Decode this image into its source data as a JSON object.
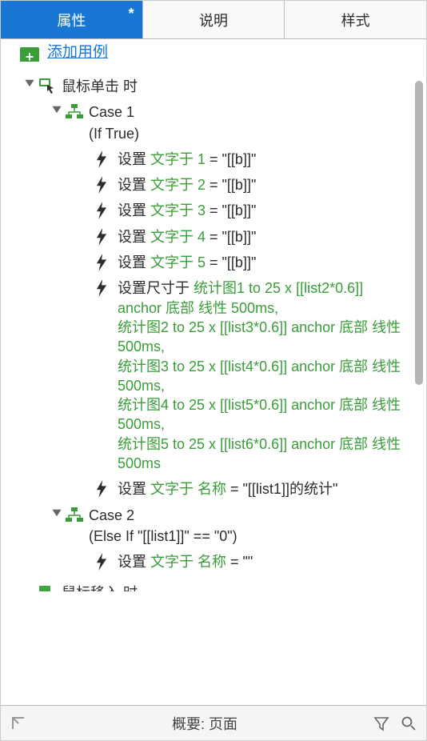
{
  "tabs": {
    "t0": "属性",
    "t1": "说明",
    "t2": "样式",
    "dirty": "*"
  },
  "partial_link": "添加用例",
  "event": {
    "label": "鼠标单击 时"
  },
  "case1": {
    "title": "Case 1",
    "cond": "(If True)",
    "a1": {
      "pre": "设置 ",
      "kw": "文字于 1",
      "post": " = \"[[b]]\""
    },
    "a2": {
      "pre": "设置 ",
      "kw": "文字于 2",
      "post": " = \"[[b]]\""
    },
    "a3": {
      "pre": "设置 ",
      "kw": "文字于 3",
      "post": " = \"[[b]]\""
    },
    "a4": {
      "pre": "设置 ",
      "kw": "文字于 4",
      "post": " = \"[[b]]\""
    },
    "a5": {
      "pre": "设置 ",
      "kw": "文字于 5",
      "post": " = \"[[b]]\""
    },
    "a6": {
      "pre": "设置尺寸于 ",
      "kw": "统计图1 to 25 x [[list2*0.6]] anchor 底部 线性 500ms,\n统计图2 to 25 x [[list3*0.6]] anchor 底部 线性 500ms,\n统计图3 to 25 x [[list4*0.6]] anchor 底部 线性 500ms,\n统计图4 to 25 x [[list5*0.6]] anchor 底部 线性 500ms,\n统计图5 to 25 x [[list6*0.6]] anchor 底部 线性 500ms"
    },
    "a7": {
      "pre": "设置 ",
      "kw": "文字于 名称",
      "post": " = \"[[list1]]的统计\""
    }
  },
  "case2": {
    "title": "Case 2",
    "cond": "(Else If \"[[list1]]\" == \"0\")",
    "a1": {
      "pre": "设置 ",
      "kw": "文字于 名称",
      "post": " = \"\""
    }
  },
  "cut_event": "鼠标移入 时",
  "footer": {
    "title": "概要: 页面"
  },
  "colors": {
    "accent": "#1976d2",
    "keyword": "#3a9d3a"
  }
}
